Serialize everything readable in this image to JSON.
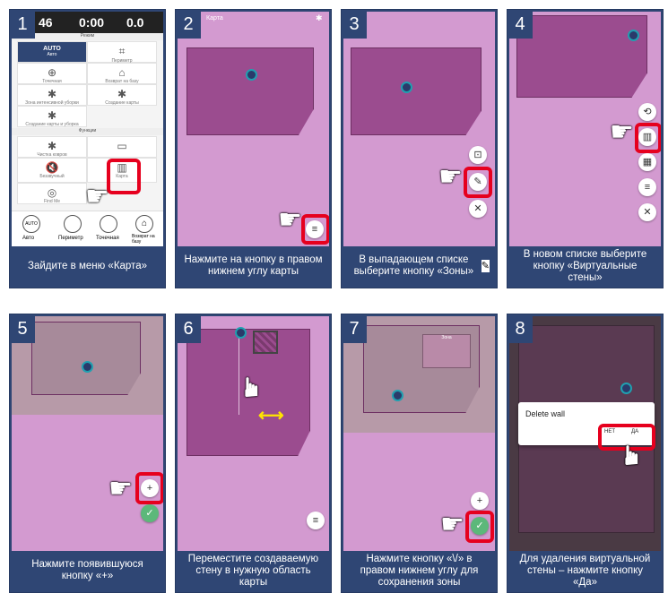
{
  "steps": [
    {
      "num": "1",
      "caption": "Зайдите в меню «Карта»"
    },
    {
      "num": "2",
      "caption": "Нажмите на кнопку в правом нижнем углу карты"
    },
    {
      "num": "3",
      "caption": "В выпадающем списке выберите кнопку «Зоны»"
    },
    {
      "num": "4",
      "caption": "В новом списке выберите кнопку «Виртуальные стены»"
    },
    {
      "num": "5",
      "caption": "Нажмите появившуюся кнопку «+»"
    },
    {
      "num": "6",
      "caption": "Переместите создаваемую стену в нужную область карты"
    },
    {
      "num": "7",
      "caption": "Нажмите кнопку «\\/» в правом нижнем углу для сохранения зоны"
    },
    {
      "num": "8",
      "caption": "Для удаления виртуальной стены – нажмите кнопку «Да»"
    }
  ],
  "phone": {
    "temp": "46",
    "time": "0:00",
    "area": "0.0",
    "mode_label": "Режим",
    "auto": "AUTO",
    "auto_sub": "Авто",
    "perimeter": "Периметр",
    "spot": "Точечная",
    "return": "Возврат на базу",
    "intensive": "Зона интенсивной уборки",
    "create_map": "Создание карты",
    "create_map_clean": "Создание карты и уборка",
    "functions": "Функции",
    "clean_carpet": "Чистка ковров",
    "sound": "Беззвучный",
    "map": "Карта",
    "find": "Find Me",
    "bottom": [
      "Авто",
      "Периметр",
      "Точечная",
      "Возврат на базу"
    ]
  },
  "screen2_title": "Карта",
  "zone4_label": "Зона",
  "dialog": {
    "title": "Delete wall",
    "no": "НЕТ",
    "yes": "ДА"
  },
  "menu_icons": [
    "pencil-icon",
    "close-icon",
    "restore-icon",
    "virtual-wall-icon",
    "zone-icon",
    "stripes-icon",
    "plus-icon",
    "check-icon",
    "menu-icon"
  ],
  "colors": {
    "panel": "#2f4674",
    "highlight": "#e6001e",
    "map": "#9b4c8f",
    "bg": "#d39ad0"
  }
}
